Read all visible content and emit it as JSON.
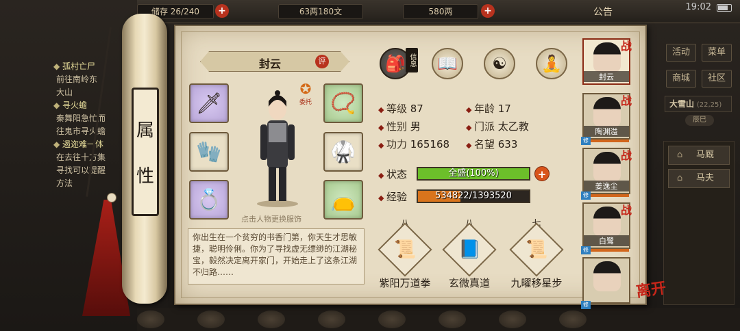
{
  "topbar": {
    "partial_label": "储存 26/240",
    "silver": "63两180文",
    "gold": "580两",
    "notice": "公告",
    "time": "19:02"
  },
  "quests": [
    {
      "title": "孤村亡尸",
      "lines": [
        "前往南岭东",
        "大山"
      ]
    },
    {
      "title": "寻火蟾",
      "lines": [
        "秦舞阳急忙而",
        "往鬼市寻火蟾"
      ]
    },
    {
      "title": "遏迩难一体",
      "lines": [
        "在去往十方集",
        "寻找可以提醒",
        "方法"
      ]
    }
  ],
  "right_menu": {
    "row1": [
      "活动",
      "菜单"
    ],
    "row2": [
      "商城",
      "社区"
    ],
    "location": "大雪山",
    "coords": "(22,25)",
    "sub_location": "辰巳",
    "npcs": [
      "马厩",
      "马夫"
    ]
  },
  "roll_label": [
    "属",
    "性"
  ],
  "character": {
    "name": "封云",
    "eval": "评",
    "entrust": "委托",
    "hint": "点击人物更换服饰",
    "bio": "你出生在一个贫穷的书香门第，你天生才思敏捷，聪明伶俐。你为了寻找虚无缥缈的江湖秘宝，毅然决定离开家门，开始走上了这条江湖不归路……"
  },
  "tabs": [
    {
      "name": "信息",
      "icon": "bag-icon"
    },
    {
      "name": "",
      "icon": "book-icon"
    },
    {
      "name": "",
      "icon": "yinyang-icon"
    },
    {
      "name": "",
      "icon": "meridian-icon"
    }
  ],
  "stats": {
    "level_k": "等级",
    "level_v": "87",
    "age_k": "年龄",
    "age_v": "17",
    "gender_k": "性别",
    "gender_v": "男",
    "sect_k": "门派",
    "sect_v": "太乙教",
    "power_k": "功力",
    "power_v": "165168",
    "fame_k": "名望",
    "fame_v": "633"
  },
  "status": {
    "label": "状态",
    "text": "全盛(100%)",
    "fraction": 1.0,
    "color": "#6cbf2a"
  },
  "exp": {
    "label": "经验",
    "text": "534822/1393520",
    "fraction": 0.384,
    "color": "#d9741c"
  },
  "skills": [
    {
      "level": "八",
      "name": "紫阳万道拳",
      "icon": "fist-manual-icon"
    },
    {
      "level": "八",
      "name": "玄微真道",
      "icon": "inner-manual-icon"
    },
    {
      "level": "七",
      "name": "九曜移星步",
      "icon": "step-manual-icon"
    }
  ],
  "party": [
    {
      "name": "封云",
      "tag": "战",
      "xiu": "修"
    },
    {
      "name": "陶渊溢",
      "tag": "战",
      "xiu": "修"
    },
    {
      "name": "姜逸尘",
      "tag": "战",
      "xiu": "修"
    },
    {
      "name": "白鹭",
      "tag": "战",
      "xiu": "修"
    },
    {
      "name": "",
      "tag": "",
      "xiu": ""
    }
  ],
  "leave": "离开",
  "colors": {
    "accent_red": "#b8321e",
    "paper": "#e7dcc3",
    "status_green": "#6cbf2a",
    "exp_orange": "#d9741c"
  }
}
